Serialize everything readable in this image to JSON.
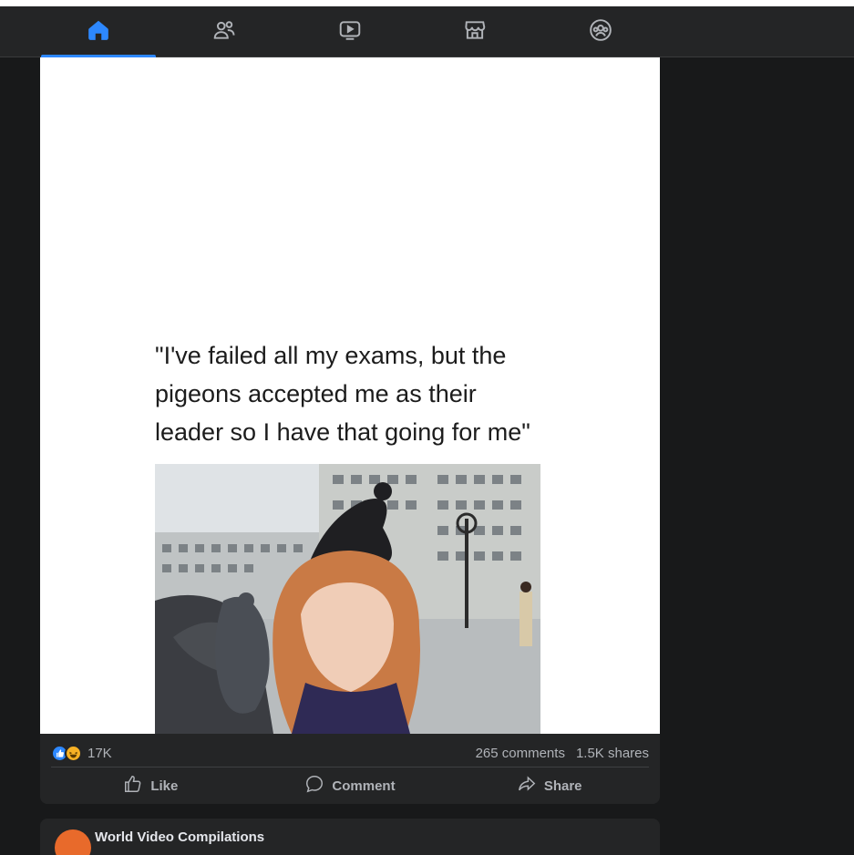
{
  "nav": {
    "tabs": [
      {
        "icon": "home-icon",
        "active": true
      },
      {
        "icon": "friends-icon",
        "active": false
      },
      {
        "icon": "watch-icon",
        "active": false
      },
      {
        "icon": "marketplace-icon",
        "active": false
      },
      {
        "icon": "groups-icon",
        "active": false
      }
    ],
    "accent": "#2d88ff"
  },
  "post": {
    "image": {
      "caption_line1": "\"I've failed all my exams, but the",
      "caption_line2": "pigeons accepted me as their",
      "caption_line3": "leader so I have that going for me\""
    },
    "reaction_count": "17K",
    "comments": "265 comments",
    "shares": "1.5K shares",
    "actions": {
      "like": "Like",
      "comment": "Comment",
      "share": "Share"
    }
  },
  "next_post": {
    "author": "World Video Compilations"
  }
}
